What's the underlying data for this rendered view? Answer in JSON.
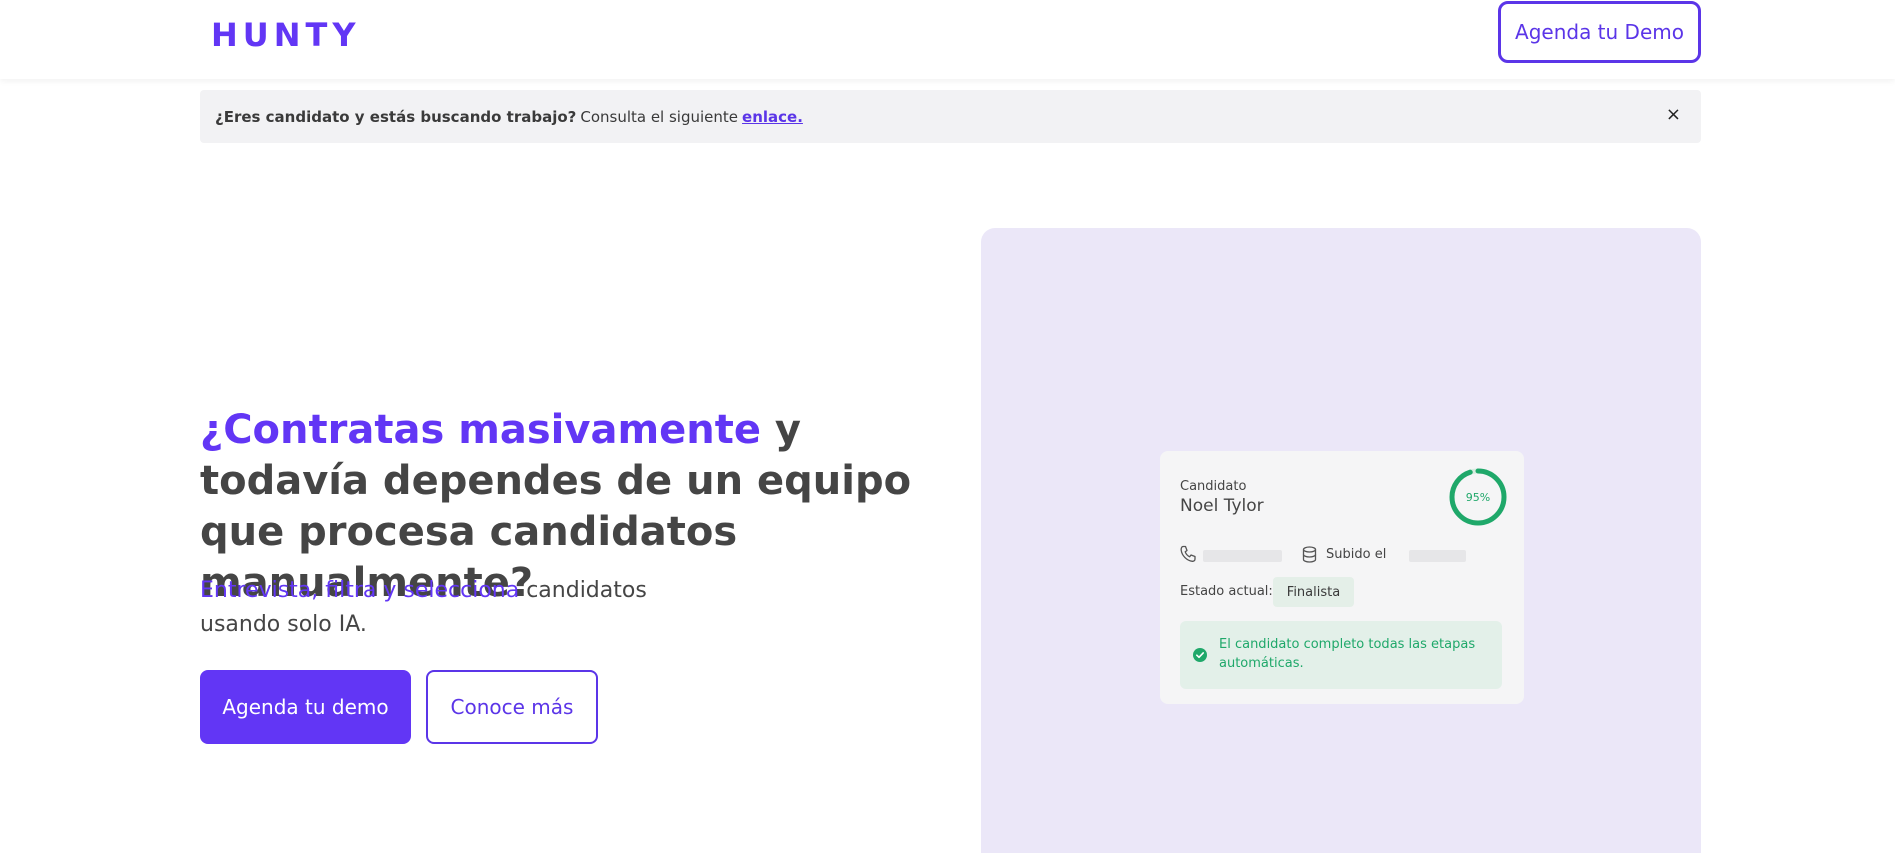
{
  "header": {
    "logo": "HUNTY",
    "demo_button": "Agenda tu Demo"
  },
  "notice": {
    "bold_text": "¿Eres candidato y estás buscando trabajo?",
    "text": "Consulta el siguiente",
    "link": "enlace.",
    "close": "×"
  },
  "hero": {
    "title_accent": "¿Contratas masivamente",
    "title_rest": " y todavía dependes de un equipo que procesa candidatos manualmente?",
    "subtitle_accent": "Entrevista, filtra y selecciona",
    "subtitle_rest": " candidatos usando solo IA.",
    "primary_button": "Agenda tu demo",
    "secondary_button": "Conoce más"
  },
  "card": {
    "candidate_label": "Candidato",
    "candidate_name": "Noel Tylor",
    "score_text": "95%",
    "score_value": 95,
    "uploaded_label": "Subido el",
    "status_label": "Estado actual:",
    "status_value": "Finalista",
    "success_message": "El candidato completo todas las etapas automáticas."
  },
  "colors": {
    "brand": "#6236f5",
    "success": "#1fa86a",
    "panel_bg": "#ebe7f8"
  }
}
